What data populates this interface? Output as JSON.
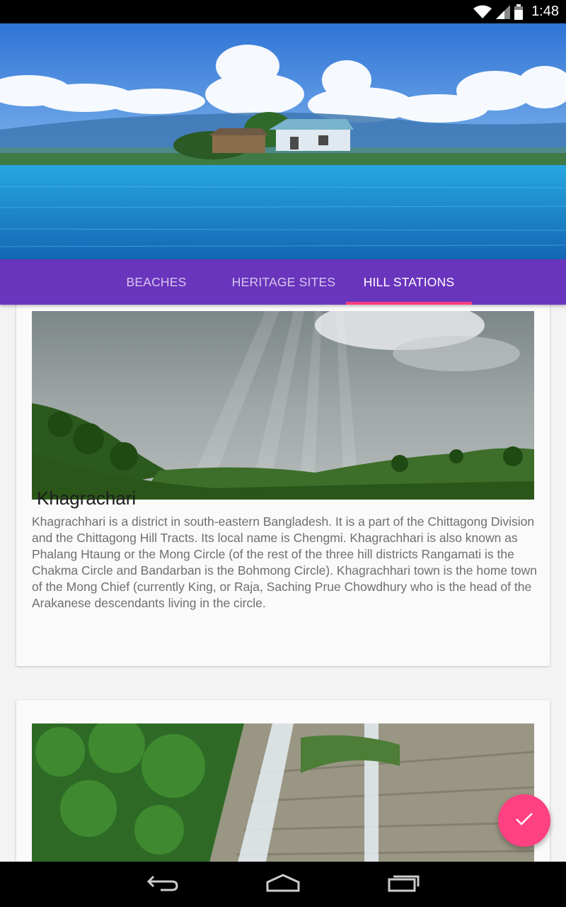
{
  "status_bar": {
    "time": "1:48",
    "icons": [
      "wifi-icon",
      "cell-signal-icon",
      "battery-icon"
    ]
  },
  "tabs": [
    {
      "label": "BEACHES",
      "active": false
    },
    {
      "label": "HERITAGE SITES",
      "active": false
    },
    {
      "label": "HILL STATIONS",
      "active": true
    }
  ],
  "colors": {
    "tab_bar": "#6a35bd",
    "accent": "#ff4081",
    "card_background": "#fafafa",
    "page_background": "#f3f3f3"
  },
  "cards": [
    {
      "title": "Khagrachari",
      "description": "Khagrachhari is a district in south-eastern Bangladesh. It is a part of the Chittagong Division and the Chittagong Hill Tracts. Its local name is Chengmi. Khagrachhari is also known as Phalang Htaung or the Mong Circle (of the rest of the three hill districts Rangamati is the Chakma Circle and Bandarban is the Bohmong Circle). Khagrachhari town is the home town of the Mong Chief (currently King, or Raja, Saching Prue Chowdhury who is the head of the Arakanese descendants living in the circle."
    },
    {
      "title": "",
      "description": ""
    }
  ],
  "fab": {
    "icon": "check-icon"
  },
  "nav_bar": {
    "buttons": [
      "back-icon",
      "home-icon",
      "recents-icon"
    ]
  }
}
